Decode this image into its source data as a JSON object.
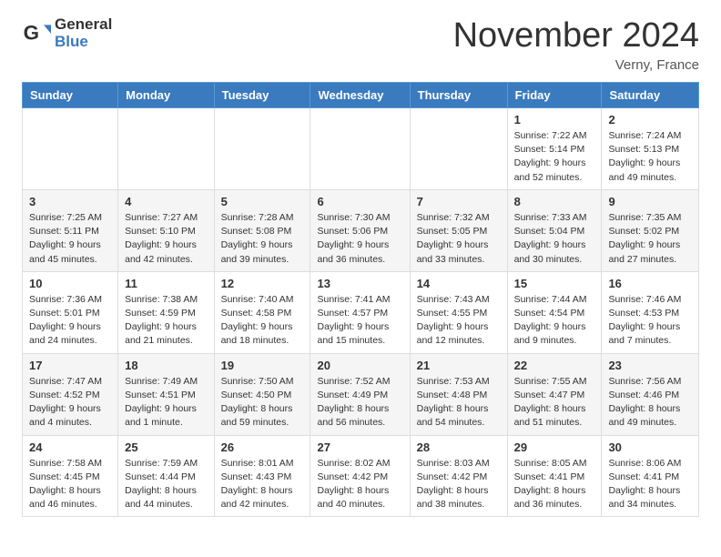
{
  "header": {
    "logo_general": "General",
    "logo_blue": "Blue",
    "month_title": "November 2024",
    "location": "Verny, France"
  },
  "days_of_week": [
    "Sunday",
    "Monday",
    "Tuesday",
    "Wednesday",
    "Thursday",
    "Friday",
    "Saturday"
  ],
  "weeks": [
    [
      {
        "day": "",
        "info": ""
      },
      {
        "day": "",
        "info": ""
      },
      {
        "day": "",
        "info": ""
      },
      {
        "day": "",
        "info": ""
      },
      {
        "day": "",
        "info": ""
      },
      {
        "day": "1",
        "info": "Sunrise: 7:22 AM\nSunset: 5:14 PM\nDaylight: 9 hours and 52 minutes."
      },
      {
        "day": "2",
        "info": "Sunrise: 7:24 AM\nSunset: 5:13 PM\nDaylight: 9 hours and 49 minutes."
      }
    ],
    [
      {
        "day": "3",
        "info": "Sunrise: 7:25 AM\nSunset: 5:11 PM\nDaylight: 9 hours and 45 minutes."
      },
      {
        "day": "4",
        "info": "Sunrise: 7:27 AM\nSunset: 5:10 PM\nDaylight: 9 hours and 42 minutes."
      },
      {
        "day": "5",
        "info": "Sunrise: 7:28 AM\nSunset: 5:08 PM\nDaylight: 9 hours and 39 minutes."
      },
      {
        "day": "6",
        "info": "Sunrise: 7:30 AM\nSunset: 5:06 PM\nDaylight: 9 hours and 36 minutes."
      },
      {
        "day": "7",
        "info": "Sunrise: 7:32 AM\nSunset: 5:05 PM\nDaylight: 9 hours and 33 minutes."
      },
      {
        "day": "8",
        "info": "Sunrise: 7:33 AM\nSunset: 5:04 PM\nDaylight: 9 hours and 30 minutes."
      },
      {
        "day": "9",
        "info": "Sunrise: 7:35 AM\nSunset: 5:02 PM\nDaylight: 9 hours and 27 minutes."
      }
    ],
    [
      {
        "day": "10",
        "info": "Sunrise: 7:36 AM\nSunset: 5:01 PM\nDaylight: 9 hours and 24 minutes."
      },
      {
        "day": "11",
        "info": "Sunrise: 7:38 AM\nSunset: 4:59 PM\nDaylight: 9 hours and 21 minutes."
      },
      {
        "day": "12",
        "info": "Sunrise: 7:40 AM\nSunset: 4:58 PM\nDaylight: 9 hours and 18 minutes."
      },
      {
        "day": "13",
        "info": "Sunrise: 7:41 AM\nSunset: 4:57 PM\nDaylight: 9 hours and 15 minutes."
      },
      {
        "day": "14",
        "info": "Sunrise: 7:43 AM\nSunset: 4:55 PM\nDaylight: 9 hours and 12 minutes."
      },
      {
        "day": "15",
        "info": "Sunrise: 7:44 AM\nSunset: 4:54 PM\nDaylight: 9 hours and 9 minutes."
      },
      {
        "day": "16",
        "info": "Sunrise: 7:46 AM\nSunset: 4:53 PM\nDaylight: 9 hours and 7 minutes."
      }
    ],
    [
      {
        "day": "17",
        "info": "Sunrise: 7:47 AM\nSunset: 4:52 PM\nDaylight: 9 hours and 4 minutes."
      },
      {
        "day": "18",
        "info": "Sunrise: 7:49 AM\nSunset: 4:51 PM\nDaylight: 9 hours and 1 minute."
      },
      {
        "day": "19",
        "info": "Sunrise: 7:50 AM\nSunset: 4:50 PM\nDaylight: 8 hours and 59 minutes."
      },
      {
        "day": "20",
        "info": "Sunrise: 7:52 AM\nSunset: 4:49 PM\nDaylight: 8 hours and 56 minutes."
      },
      {
        "day": "21",
        "info": "Sunrise: 7:53 AM\nSunset: 4:48 PM\nDaylight: 8 hours and 54 minutes."
      },
      {
        "day": "22",
        "info": "Sunrise: 7:55 AM\nSunset: 4:47 PM\nDaylight: 8 hours and 51 minutes."
      },
      {
        "day": "23",
        "info": "Sunrise: 7:56 AM\nSunset: 4:46 PM\nDaylight: 8 hours and 49 minutes."
      }
    ],
    [
      {
        "day": "24",
        "info": "Sunrise: 7:58 AM\nSunset: 4:45 PM\nDaylight: 8 hours and 46 minutes."
      },
      {
        "day": "25",
        "info": "Sunrise: 7:59 AM\nSunset: 4:44 PM\nDaylight: 8 hours and 44 minutes."
      },
      {
        "day": "26",
        "info": "Sunrise: 8:01 AM\nSunset: 4:43 PM\nDaylight: 8 hours and 42 minutes."
      },
      {
        "day": "27",
        "info": "Sunrise: 8:02 AM\nSunset: 4:42 PM\nDaylight: 8 hours and 40 minutes."
      },
      {
        "day": "28",
        "info": "Sunrise: 8:03 AM\nSunset: 4:42 PM\nDaylight: 8 hours and 38 minutes."
      },
      {
        "day": "29",
        "info": "Sunrise: 8:05 AM\nSunset: 4:41 PM\nDaylight: 8 hours and 36 minutes."
      },
      {
        "day": "30",
        "info": "Sunrise: 8:06 AM\nSunset: 4:41 PM\nDaylight: 8 hours and 34 minutes."
      }
    ]
  ]
}
